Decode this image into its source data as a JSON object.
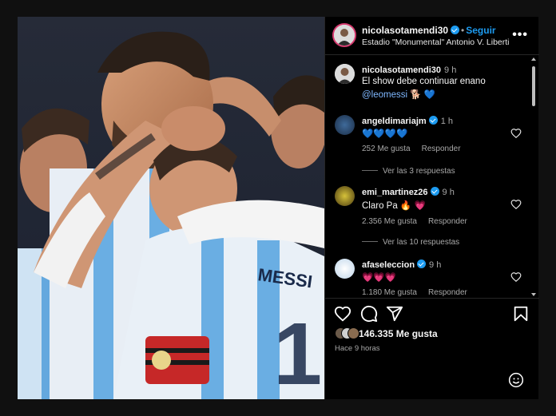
{
  "post": {
    "author": "nicolasotamendi30",
    "follow_label": "Seguir",
    "location": "Estadio \"Monumental\" Antonio V. Liberti",
    "caption_time": "9 h",
    "caption_line1": "El show debe continuar enano",
    "caption_mention": "@leomessi",
    "caption_emojis": "🐕 💙"
  },
  "comments": [
    {
      "user": "angeldimariajm",
      "time": "1 h",
      "text": "💙💙💙💙",
      "likes": "252 Me gusta",
      "reply_label": "Responder",
      "view_replies": "Ver las 3 respuestas"
    },
    {
      "user": "emi_martinez26",
      "time": "9 h",
      "text": "Claro Pa 🔥 💗",
      "likes": "2.356 Me gusta",
      "reply_label": "Responder",
      "view_replies": "Ver las 10 respuestas"
    },
    {
      "user": "afaseleccion",
      "time": "9 h",
      "text": "💗💗💗",
      "likes": "1.180 Me gusta",
      "reply_label": "Responder"
    }
  ],
  "engagement": {
    "likes_text": "146.335 Me gusta",
    "posted_ago": "Hace 9 horas"
  },
  "icons": {
    "more": "more-options-icon",
    "like": "heart-icon",
    "comment": "comment-icon",
    "share": "share-icon",
    "save": "bookmark-icon",
    "emoji": "smiley-icon"
  },
  "colors": {
    "accent": "#1d9bf0",
    "verified": "#1d9bf0",
    "muted": "#a8a8a8"
  }
}
